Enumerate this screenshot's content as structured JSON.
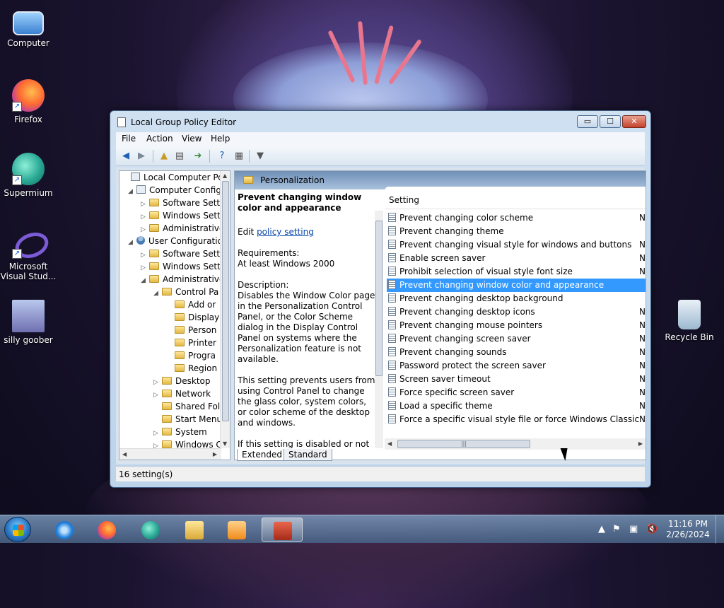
{
  "desktop": {
    "icons": [
      {
        "label": "Computer"
      },
      {
        "label": "Firefox"
      },
      {
        "label": "Supermium"
      },
      {
        "label": "Microsoft Visual Stud..."
      },
      {
        "label": "silly goober"
      },
      {
        "label": "Recycle Bin"
      }
    ]
  },
  "window": {
    "title": "Local Group Policy Editor",
    "controls": {
      "minimize": "▭",
      "maximize": "☐",
      "close": "✕"
    },
    "menu": [
      "File",
      "Action",
      "View",
      "Help"
    ],
    "toolbar_icons": [
      "back-arrow-icon",
      "forward-arrow-icon",
      "up-folder-icon",
      "show-hide-tree-icon",
      "export-list-icon",
      "help-icon",
      "properties-icon",
      "filter-icon"
    ],
    "tree": [
      {
        "label": "Local Computer Polic",
        "expander": "",
        "icon": "policy"
      },
      {
        "label": "Computer Config",
        "expander": "◢",
        "icon": "pc"
      },
      {
        "label": "Software Setti",
        "expander": "▷",
        "icon": "folder"
      },
      {
        "label": "Windows Sett",
        "expander": "▷",
        "icon": "folder"
      },
      {
        "label": "Administrative",
        "expander": "▷",
        "icon": "folder"
      },
      {
        "label": "User Configuratio",
        "expander": "◢",
        "icon": "user"
      },
      {
        "label": "Software Setti",
        "expander": "▷",
        "icon": "folder"
      },
      {
        "label": "Windows Sett",
        "expander": "▷",
        "icon": "folder"
      },
      {
        "label": "Administrative",
        "expander": "◢",
        "icon": "folder"
      },
      {
        "label": "Control Pa",
        "expander": "◢",
        "icon": "folder"
      },
      {
        "label": "Add or",
        "expander": "",
        "icon": "folder"
      },
      {
        "label": "Display",
        "expander": "",
        "icon": "folder"
      },
      {
        "label": "Person",
        "expander": "",
        "icon": "folder"
      },
      {
        "label": "Printer",
        "expander": "",
        "icon": "folder"
      },
      {
        "label": "Progra",
        "expander": "",
        "icon": "folder"
      },
      {
        "label": "Region",
        "expander": "",
        "icon": "folder"
      },
      {
        "label": "Desktop",
        "expander": "▷",
        "icon": "folder"
      },
      {
        "label": "Network",
        "expander": "▷",
        "icon": "folder"
      },
      {
        "label": "Shared Fol",
        "expander": "",
        "icon": "folder"
      },
      {
        "label": "Start Menu",
        "expander": "",
        "icon": "folder"
      },
      {
        "label": "System",
        "expander": "▷",
        "icon": "folder"
      },
      {
        "label": "Windows C",
        "expander": "▷",
        "icon": "folder"
      }
    ],
    "pane_header": "Personalization",
    "description": {
      "title": "Prevent changing window color and appearance",
      "edit_prefix": "Edit ",
      "edit_link": "policy setting",
      "requirements_label": "Requirements:",
      "requirements_value": "At least Windows 2000",
      "description_label": "Description:",
      "description_text": "Disables the Window Color page in the Personalization Control Panel, or the Color Scheme dialog in the Display Control Panel on systems where the Personalization feature is not available.",
      "paragraph2": "This setting prevents users from using Control Panel to change the glass color, system colors, or color scheme of the desktop and windows.",
      "paragraph3": "If this setting is disabled or not configured, the Window Color"
    },
    "list": {
      "header": "Setting",
      "rows": [
        {
          "name": "Prevent changing color scheme",
          "state": "N",
          "selected": false
        },
        {
          "name": "Prevent changing theme",
          "state": "",
          "selected": false
        },
        {
          "name": "Prevent changing visual style for windows and buttons",
          "state": "N",
          "selected": false
        },
        {
          "name": "Enable screen saver",
          "state": "N",
          "selected": false
        },
        {
          "name": "Prohibit selection of visual style font size",
          "state": "N",
          "selected": false
        },
        {
          "name": "Prevent changing window color and appearance",
          "state": "",
          "selected": true
        },
        {
          "name": "Prevent changing desktop background",
          "state": "",
          "selected": false
        },
        {
          "name": "Prevent changing desktop icons",
          "state": "N",
          "selected": false
        },
        {
          "name": "Prevent changing mouse pointers",
          "state": "N",
          "selected": false
        },
        {
          "name": "Prevent changing screen saver",
          "state": "N",
          "selected": false
        },
        {
          "name": "Prevent changing sounds",
          "state": "N",
          "selected": false
        },
        {
          "name": "Password protect the screen saver",
          "state": "N",
          "selected": false
        },
        {
          "name": "Screen saver timeout",
          "state": "N",
          "selected": false
        },
        {
          "name": "Force specific screen saver",
          "state": "N",
          "selected": false
        },
        {
          "name": "Load a specific theme",
          "state": "N",
          "selected": false
        },
        {
          "name": "Force a specific visual style file or force Windows Classic",
          "state": "N",
          "selected": false
        }
      ]
    },
    "tabs": [
      "Extended",
      "Standard"
    ],
    "status": "16 setting(s)"
  },
  "taskbar": {
    "time": "11:16 PM",
    "date": "2/26/2024",
    "colors": {
      "selection": "#3399ff"
    }
  }
}
